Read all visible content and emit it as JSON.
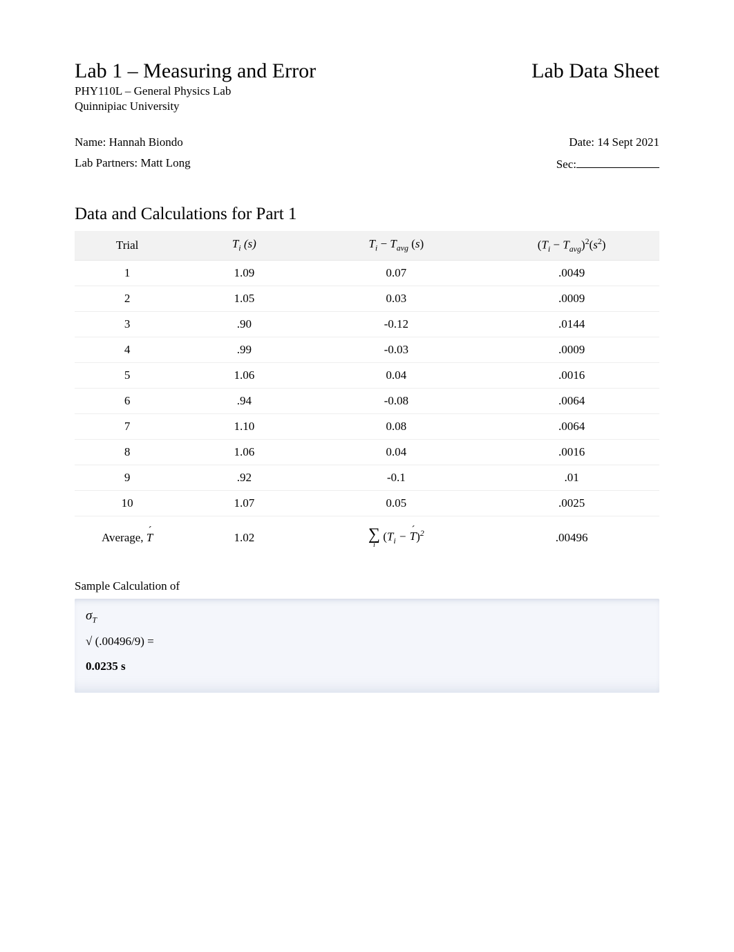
{
  "header": {
    "lab_title": "Lab 1 – Measuring and Error",
    "sheet_title": "Lab Data Sheet",
    "course": "PHY110L – General Physics Lab",
    "university": "Quinnipiac University"
  },
  "info": {
    "name_label": "Name: ",
    "name_value": "Hannah Biondo",
    "date_label": "Date: ",
    "date_value": "14 Sept 2021",
    "partners_label": "Lab Partners: ",
    "partners_value": "Matt Long",
    "sec_label": "Sec:"
  },
  "section_heading": "Data and Calculations for Part 1",
  "table": {
    "headers": {
      "trial": "Trial",
      "ti_label": "T",
      "ti_unit": " (s)",
      "diff_left": "T",
      "diff_dash": "−",
      "diff_right": "T",
      "diff_unit": "s",
      "sq_left": "T",
      "sq_dash": "−",
      "sq_right": "T",
      "sq_unit_s": "s"
    },
    "rows": [
      {
        "trial": "1",
        "ti": "1.09",
        "diff": "0.07",
        "sq": ".0049"
      },
      {
        "trial": "2",
        "ti": "1.05",
        "diff": "0.03",
        "sq": ".0009"
      },
      {
        "trial": "3",
        "ti": ".90",
        "diff": "-0.12",
        "sq": ".0144"
      },
      {
        "trial": "4",
        "ti": ".99",
        "diff": "-0.03",
        "sq": ".0009"
      },
      {
        "trial": "5",
        "ti": "1.06",
        "diff": "0.04",
        "sq": ".0016"
      },
      {
        "trial": "6",
        "ti": ".94",
        "diff": "-0.08",
        "sq": ".0064"
      },
      {
        "trial": "7",
        "ti": "1.10",
        "diff": "0.08",
        "sq": ".0064"
      },
      {
        "trial": "8",
        "ti": "1.06",
        "diff": "0.04",
        "sq": ".0016"
      },
      {
        "trial": "9",
        "ti": ".92",
        "diff": "-0.1",
        "sq": ".01"
      },
      {
        "trial": "10",
        "ti": "1.07",
        "diff": "0.05",
        "sq": ".0025"
      }
    ],
    "average": {
      "label": "Average,   ",
      "symbol": "T",
      "ti": "1.02",
      "sum_value": ".00496"
    }
  },
  "sample_calc": {
    "label": "Sample Calculation of",
    "sigma": "σ",
    "sigma_sub": "T",
    "expr": "√  (.00496/9) =",
    "result": "0.0235 s"
  }
}
